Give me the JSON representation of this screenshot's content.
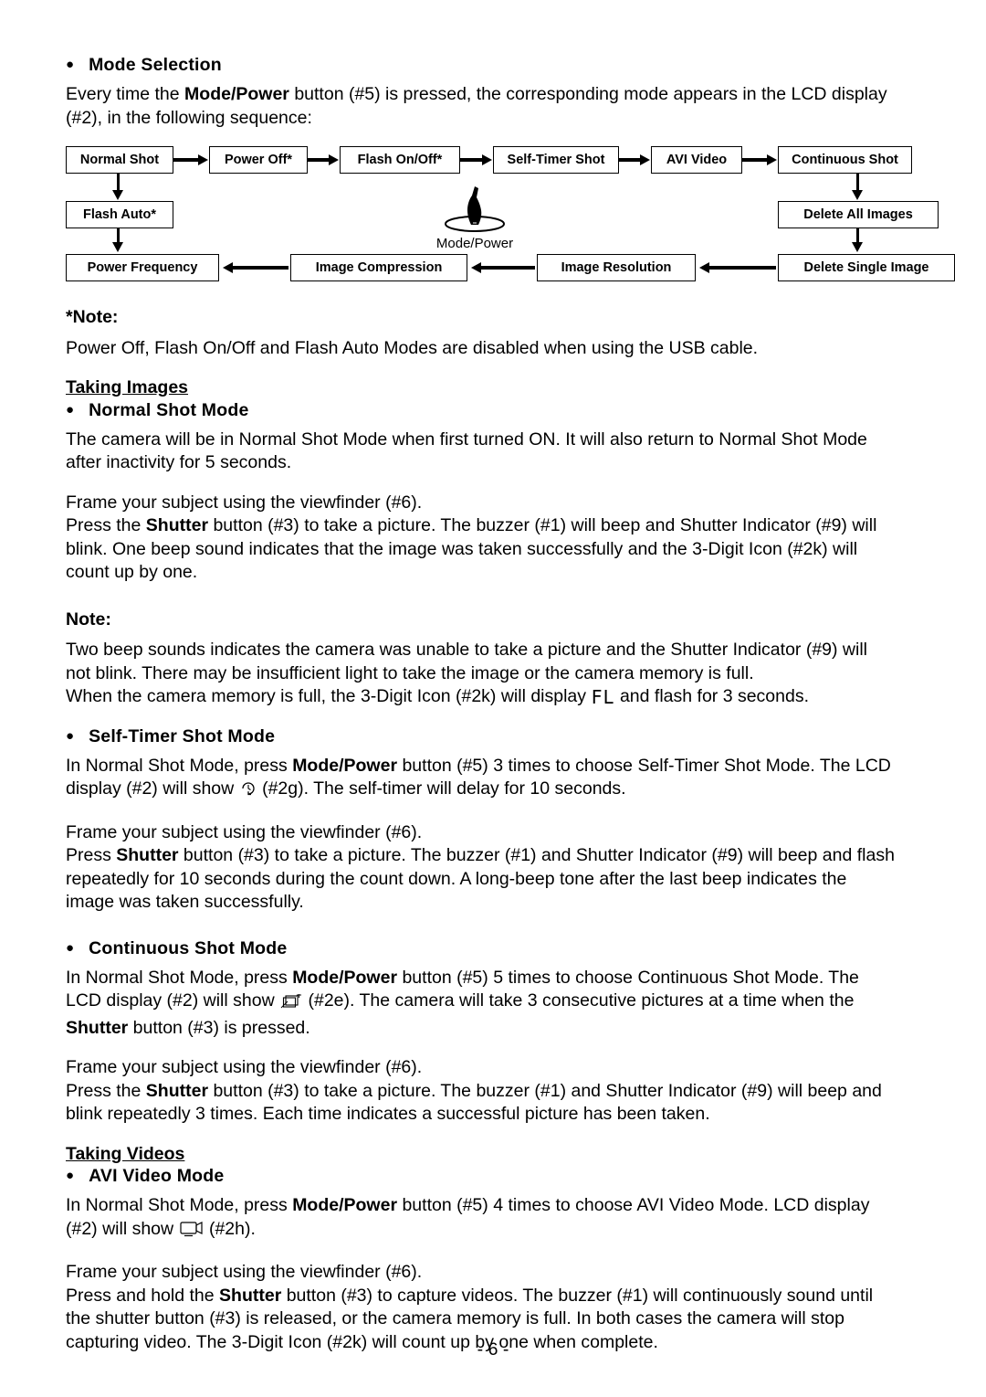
{
  "page": {
    "footer": "- 6 -"
  },
  "sections": {
    "mode_selection": {
      "heading": "Mode Selection",
      "para1_a": "Every time the ",
      "para1_b": "Mode/Power",
      "para1_c": " button (#5) is pressed, the corresponding mode appears in the LCD display",
      "para1_d": "(#2), in the following sequence:"
    },
    "diagram": {
      "boxes": [
        "Normal Shot",
        "Power Off*",
        "Flash On/Off*",
        "Self-Timer Shot",
        "AVI Video",
        "Continuous Shot",
        "Flash Auto*",
        "Delete All Images",
        "Power Frequency",
        "Image Compression",
        "Image Resolution",
        "Delete Single Image"
      ],
      "caption": "Mode/Power"
    },
    "note_star": {
      "heading": "*Note:",
      "text": "Power Off, Flash On/Off and Flash Auto Modes are disabled when using the USB cable."
    },
    "taking_images": {
      "heading": "Taking Images",
      "normal_shot": {
        "heading": "Normal Shot Mode",
        "p1_l1": "The camera will be in Normal Shot Mode when first turned ON. It will also return to Normal Shot Mode",
        "p1_l2": "after inactivity for 5 seconds.",
        "p2": "Frame your subject using the viewfinder (#6).",
        "p3_a": "Press the ",
        "p3_b": "Shutter",
        "p3_c": " button (#3) to take a picture. The buzzer (#1) will beep and Shutter Indicator (#9) will",
        "p3_l2": "blink. One beep sound indicates that the image was taken successfully and the 3-Digit Icon (#2k) will",
        "p3_l3": "count up by one."
      },
      "note": {
        "heading": "Note:",
        "l1": "Two beep sounds indicates the camera was unable to take a picture and the Shutter Indicator (#9) will",
        "l2": "not blink. There may be insufficient light to take the image or the camera memory is full.",
        "l3_a": "When the camera memory is full, the 3-Digit Icon (#2k) will display ",
        "l3_icon": "FL",
        "l3_b": " and flash for 3 seconds."
      },
      "self_timer": {
        "heading": "Self-Timer Shot Mode",
        "l1_a": "In Normal Shot Mode, press ",
        "l1_b": "Mode/Power",
        "l1_c": " button (#5) 3 times to choose Self-Timer Shot Mode. The LCD",
        "l2_a": "display (#2) will show ",
        "l2_icon": "self-timer-icon",
        "l2_b": " (#2g). The self-timer will delay for 10 seconds.",
        "p2": "Frame your subject using the viewfinder (#6).",
        "p3_a": "Press ",
        "p3_b": "Shutter",
        "p3_c": " button (#3) to take a picture. The buzzer (#1) and Shutter Indicator (#9) will beep and flash",
        "p3_l2": "repeatedly for 10 seconds during the count down. A long-beep tone after the last beep indicates the",
        "p3_l3": "image was taken successfully."
      },
      "continuous": {
        "heading": "Continuous Shot Mode",
        "l1_a": "In Normal Shot Mode, press ",
        "l1_b": "Mode/Power",
        "l1_c": " button (#5) 5 times to choose Continuous Shot Mode. The",
        "l2_a": "LCD display (#2) will show ",
        "l2_icon": "continuous-shot-icon",
        "l2_b": " (#2e). The camera will take 3 consecutive pictures at a time when the",
        "l3_a": "Shutter",
        "l3_b": " button (#3) is pressed.",
        "p2": "Frame your subject using the viewfinder (#6).",
        "p3_a": "Press the ",
        "p3_b": "Shutter",
        "p3_c": " button (#3) to take a picture. The buzzer (#1) and Shutter Indicator (#9) will beep and",
        "p3_l2": "blink repeatedly 3 times. Each time indicates a successful picture has been taken."
      }
    },
    "taking_videos": {
      "heading": "Taking Videos",
      "avi": {
        "heading": "AVI Video Mode",
        "l1_a": "In Normal Shot Mode, press ",
        "l1_b": "Mode/Power",
        "l1_c": " button (#5) 4 times to choose AVI Video Mode. LCD display",
        "l2_a": "(#2) will show ",
        "l2_icon": "avi-video-icon",
        "l2_b": " (#2h).",
        "p2": "Frame your subject using the viewfinder (#6).",
        "p3_a": "Press and hold the ",
        "p3_b": "Shutter",
        "p3_c": " button (#3) to capture videos. The buzzer (#1) will continuously sound until",
        "p3_l2": "the shutter button (#3) is released, or the camera memory is full. In both cases the camera will stop",
        "p3_l3": "capturing video. The 3-Digit Icon (#2k) will count up by one when complete."
      }
    }
  }
}
